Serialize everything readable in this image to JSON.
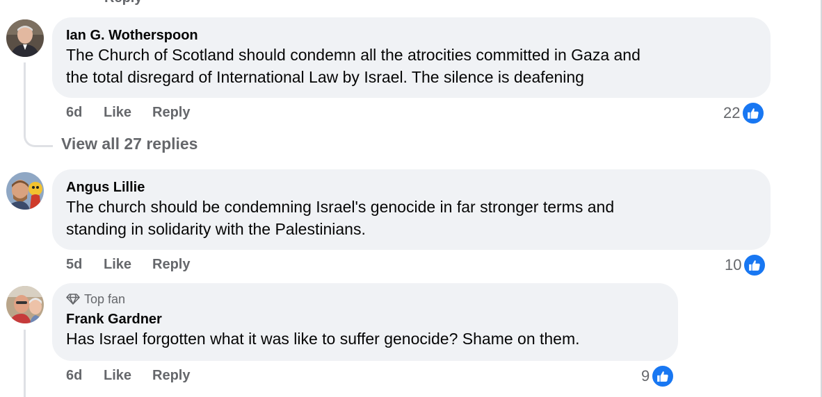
{
  "partial_top": "Reply",
  "comments": [
    {
      "author": "Ian G. Wotherspoon",
      "text": "The Church of Scotland should condemn all the atrocities committed in Gaza and\nthe total disregard of International Law by Israel. The silence is deafening",
      "time": "6d",
      "like_label": "Like",
      "reply_label": "Reply",
      "reaction_count": "22",
      "reaction_icon": "thumbs-up-icon",
      "avatar_icon": "avatar-photo"
    },
    {
      "author": "Angus Lillie",
      "text": "The church should be condemning Israel's genocide in far stronger terms and\nstanding in solidarity with the Palestinians.",
      "time": "5d",
      "like_label": "Like",
      "reply_label": "Reply",
      "reaction_count": "10",
      "reaction_icon": "thumbs-up-icon",
      "avatar_icon": "avatar-photo"
    },
    {
      "badge": "Top fan",
      "badge_icon": "diamond-icon",
      "author": "Frank Gardner",
      "text": "Has Israel forgotten what it was like to suffer genocide? Shame on them.",
      "time": "6d",
      "like_label": "Like",
      "reply_label": "Reply",
      "reaction_count": "9",
      "reaction_icon": "thumbs-up-icon",
      "avatar_icon": "avatar-photo"
    }
  ],
  "view_replies": "View all 27 replies",
  "colors": {
    "bubble_bg": "#f0f2f5",
    "secondary_text": "#65676b",
    "like_blue": "#1877f2",
    "thread_line": "#dfe1e5"
  }
}
